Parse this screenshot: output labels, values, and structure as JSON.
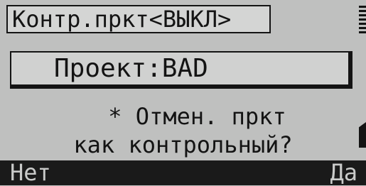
{
  "header": {
    "title": "Контр.пркт<ВЫКЛ>"
  },
  "project": {
    "label": "Проект:BAD"
  },
  "prompt": {
    "line1": "* Отмен. пркт",
    "line2": "как контрольный?"
  },
  "softkeys": {
    "left": "Нет",
    "right": "Да"
  },
  "icons": {
    "top_right": "scroll-indicator-icon",
    "bottom_right": "battery-icon"
  }
}
